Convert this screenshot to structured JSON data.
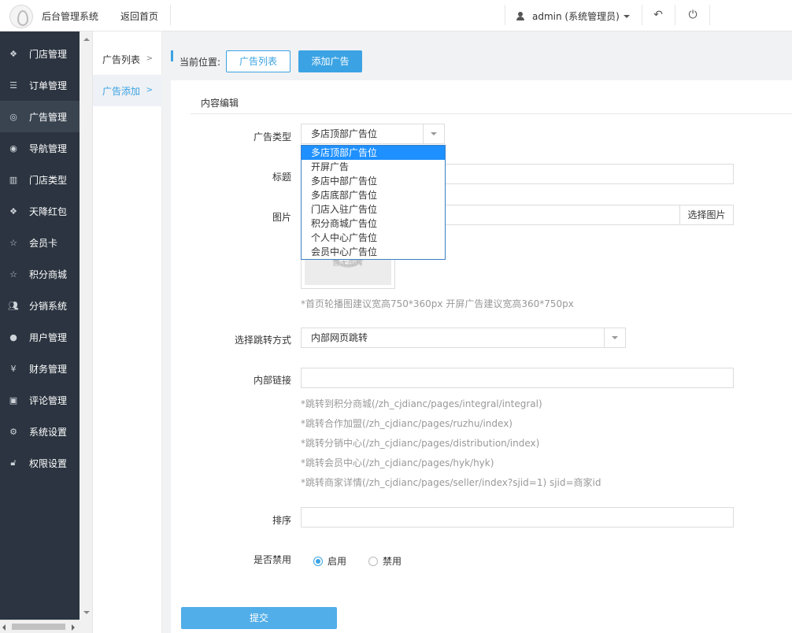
{
  "header": {
    "system_title": "后台管理系统",
    "back_home": "返回首页",
    "user_label": "admin (系统管理员)"
  },
  "sidebar": {
    "items": [
      {
        "label": "门店管理",
        "icon": "cubes-icon"
      },
      {
        "label": "订单管理",
        "icon": "list-icon"
      },
      {
        "label": "广告管理",
        "icon": "lifebuoy-icon"
      },
      {
        "label": "导航管理",
        "icon": "compass-icon"
      },
      {
        "label": "门店类型",
        "icon": "bank-icon"
      },
      {
        "label": "天降红包",
        "icon": "cubes-icon"
      },
      {
        "label": "会员卡",
        "icon": "star-icon"
      },
      {
        "label": "积分商城",
        "icon": "star-icon"
      },
      {
        "label": "分销系统",
        "icon": "users-icon"
      },
      {
        "label": "用户管理",
        "icon": "user-icon"
      },
      {
        "label": "财务管理",
        "icon": "yen-icon"
      },
      {
        "label": "评论管理",
        "icon": "money-icon"
      },
      {
        "label": "系统设置",
        "icon": "gear-icon"
      },
      {
        "label": "权限设置",
        "icon": "lock-icon"
      }
    ],
    "active_index": 2
  },
  "submenu": {
    "items": [
      {
        "label": "广告列表"
      },
      {
        "label": "广告添加"
      }
    ],
    "active_index": 1
  },
  "breadcrumb": {
    "label": "当前位置:",
    "list_button": "广告列表",
    "add_button": "添加广告"
  },
  "form": {
    "section_title": "内容编辑",
    "type_label": "广告类型",
    "type_value": "多店顶部广告位",
    "type_options": [
      "多店顶部广告位",
      "开屏广告",
      "多店中部广告位",
      "多店底部广告位",
      "门店入驻广告位",
      "积分商城广告位",
      "个人中心广告位",
      "会员中心广告位"
    ],
    "title_label": "标题",
    "title_value": "",
    "image_label": "图片",
    "pick_image_button": "选择图片",
    "no_image_text": "暂无图片",
    "image_hint": "*首页轮播图建议宽高750*360px    开屏广告建议宽高360*750px",
    "jump_label": "选择跳转方式",
    "jump_value": "内部网页跳转",
    "link_label": "内部链接",
    "link_value": "",
    "link_hints": [
      "*跳转到积分商城(/zh_cjdianc/pages/integral/integral)",
      "*跳转合作加盟(/zh_cjdianc/pages/ruzhu/index)",
      "*跳转分销中心(/zh_cjdianc/pages/distribution/index)",
      "*跳转会员中心(/zh_cjdianc/pages/hyk/hyk)",
      "*跳转商家详情(/zh_cjdianc/pages/seller/index?sjid=1) sjid=商家id"
    ],
    "sort_label": "排序",
    "sort_value": "",
    "disable_label": "是否禁用",
    "radio_enable": "启用",
    "radio_disable": "禁用",
    "radio_selected": "启用",
    "submit_button": "提交"
  },
  "colors": {
    "accent": "#3ba3e3",
    "sidebar_bg": "#2b3440",
    "dropdown_highlight": "#1e90ff"
  }
}
